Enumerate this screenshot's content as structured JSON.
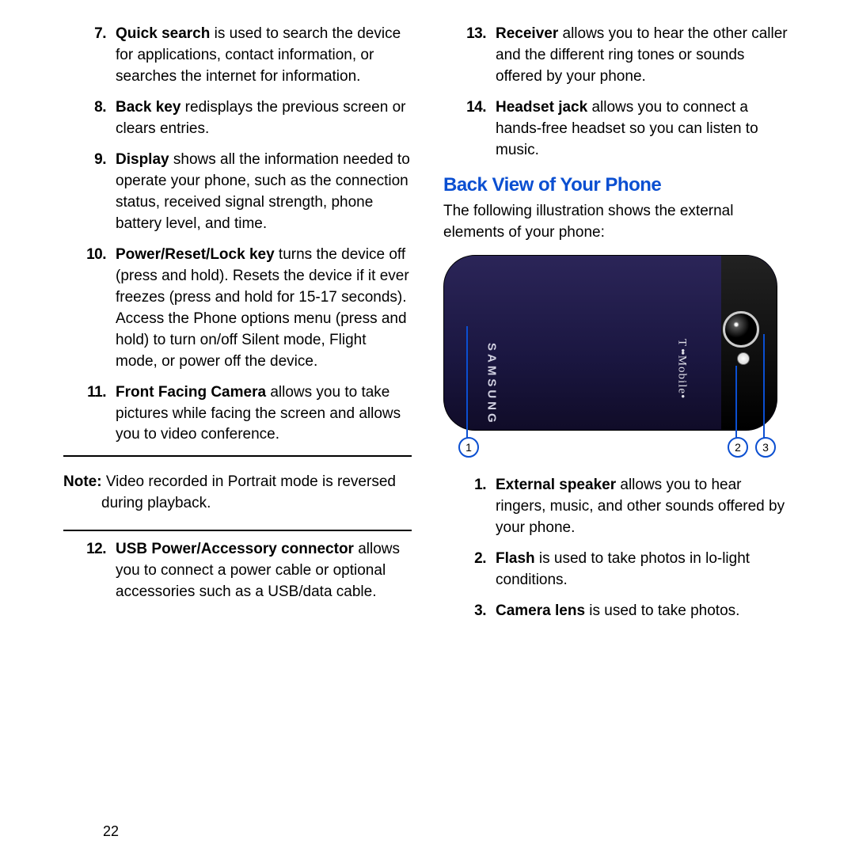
{
  "page_number": "22",
  "left_list": [
    {
      "n": "7.",
      "term": "Quick search",
      "text": " is used to search the device for applications, contact information, or searches the internet for information."
    },
    {
      "n": "8.",
      "term": "Back key",
      "text": " redisplays the previous screen or clears entries."
    },
    {
      "n": "9.",
      "term": "Display",
      "text": " shows all the information needed to operate your phone, such as the connection status, received signal strength, phone battery level, and time."
    },
    {
      "n": "10.",
      "term": "Power/Reset/Lock key",
      "text": " turns the device off (press and hold). Resets the device if it ever freezes (press and hold for 15-17 seconds). Access the Phone options menu (press and hold) to turn on/off Silent mode, Flight mode, or power off the device."
    },
    {
      "n": "11.",
      "term": "Front Facing Camera",
      "text": " allows you to take pictures while facing the screen and allows you to video conference."
    }
  ],
  "note_label": "Note:",
  "note_text": " Video recorded in Portrait mode is reversed during playback.",
  "left_list_after": [
    {
      "n": "12.",
      "term": "USB Power/Accessory connector",
      "text": " allows you to connect a power cable or optional accessories such as a USB/data cable."
    }
  ],
  "right_list_top": [
    {
      "n": "13.",
      "term": "Receiver",
      "text": " allows you to hear the other caller and the different ring tones or sounds offered by your phone."
    },
    {
      "n": "14.",
      "term": "Headset jack",
      "text": " allows you to connect a hands-free headset so you can listen to music."
    }
  ],
  "section_heading": "Back View of Your Phone",
  "intro": "The following illustration shows the external elements of your phone:",
  "brand1": "SAMSUNG",
  "brand2_pre": "T",
  "brand2_post": "Mobile",
  "callout_labels": {
    "c1": "1",
    "c2": "2",
    "c3": "3"
  },
  "right_list_bottom": [
    {
      "n": "1.",
      "term": "External speaker",
      "text": " allows you to hear ringers, music, and other sounds offered by your phone."
    },
    {
      "n": "2.",
      "term": "Flash",
      "text": " is used to take photos in lo-light conditions."
    },
    {
      "n": "3.",
      "term": "Camera lens",
      "text": " is used to take photos."
    }
  ]
}
